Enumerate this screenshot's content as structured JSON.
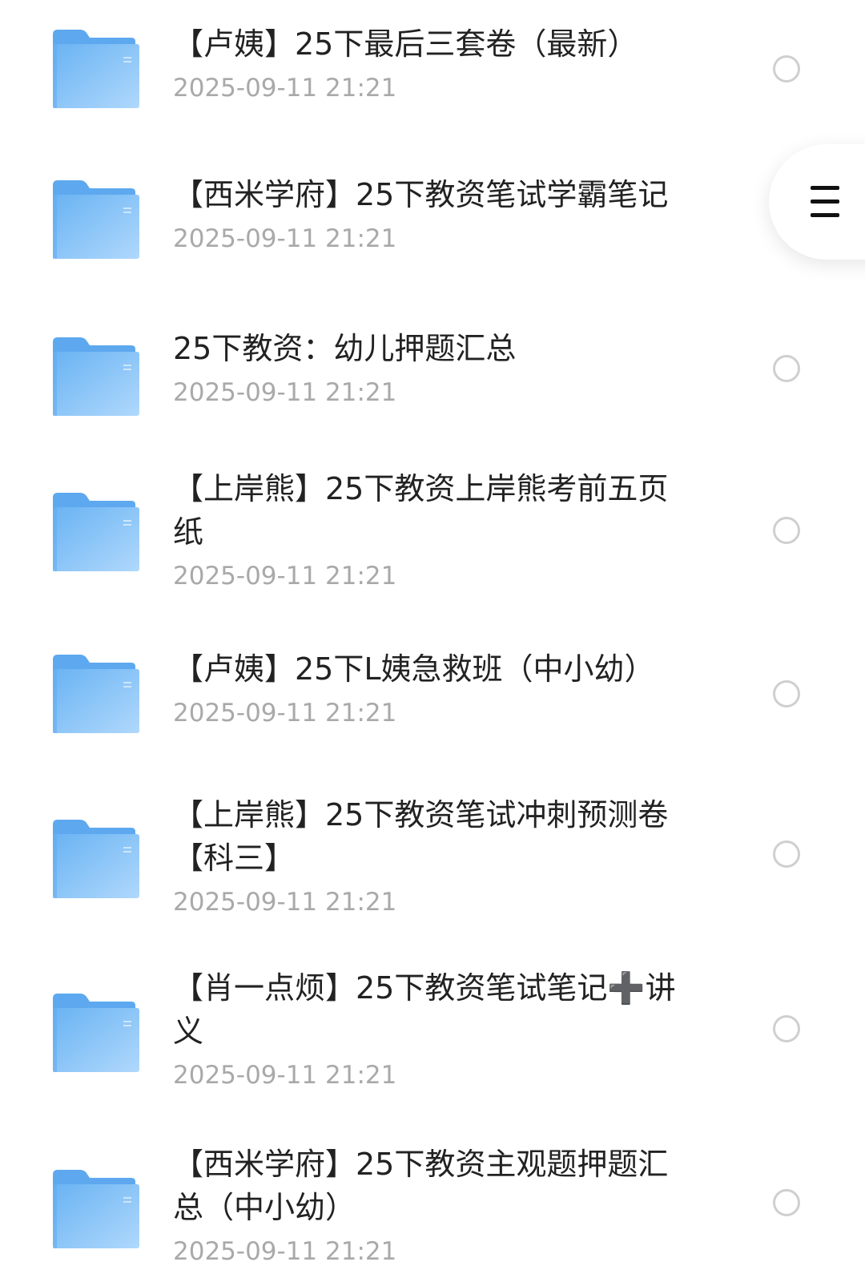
{
  "colors": {
    "folder_back": "#5ea8ef",
    "folder_front_top": "#69b3f3",
    "folder_front_bottom": "#a8d3fb",
    "name_text": "#222222",
    "date_text": "#a9a9a9",
    "radio_border": "#cfcfcf"
  },
  "icons": {
    "folder": "folder-icon",
    "menu": "hamburger-menu-icon"
  },
  "files": [
    {
      "name": "【卢姨】25下最后三套卷（最新）",
      "date": "2025-09-11 21:21"
    },
    {
      "name": "【西米学府】25下教资笔试学霸笔记",
      "date": "2025-09-11 21:21"
    },
    {
      "name": "25下教资：幼儿押题汇总",
      "date": "2025-09-11 21:21"
    },
    {
      "name": "【上岸熊】25下教资上岸熊考前五页纸",
      "date": "2025-09-11 21:21"
    },
    {
      "name": "【卢姨】25下L姨急救班（中小幼）",
      "date": "2025-09-11 21:21"
    },
    {
      "name": "【上岸熊】25下教资笔试冲刺预测卷【科三】",
      "date": "2025-09-11 21:21"
    },
    {
      "name": "【肖一点烦】25下教资笔试笔记➕讲义",
      "date": "2025-09-11 21:21"
    },
    {
      "name": "【西米学府】25下教资主观题押题汇总（中小幼）",
      "date": "2025-09-11 21:21"
    }
  ]
}
